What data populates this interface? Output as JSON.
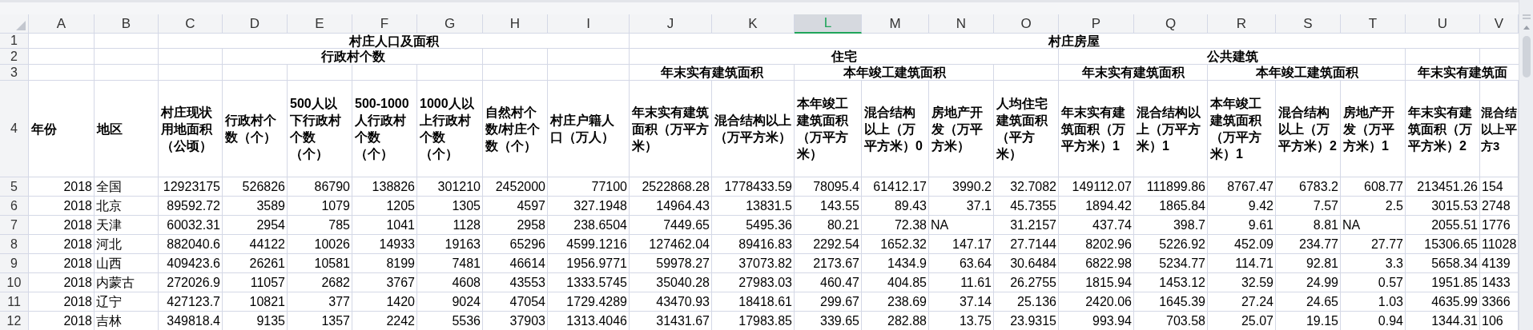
{
  "column_headers": [
    {
      "label": "A",
      "selected": false
    },
    {
      "label": "B",
      "selected": false
    },
    {
      "label": "C",
      "selected": false
    },
    {
      "label": "D",
      "selected": false
    },
    {
      "label": "E",
      "selected": false
    },
    {
      "label": "F",
      "selected": false
    },
    {
      "label": "G",
      "selected": false
    },
    {
      "label": "H",
      "selected": false
    },
    {
      "label": "I",
      "selected": false
    },
    {
      "label": "J",
      "selected": false
    },
    {
      "label": "K",
      "selected": false
    },
    {
      "label": "L",
      "selected": true
    },
    {
      "label": "M",
      "selected": false
    },
    {
      "label": "N",
      "selected": false
    },
    {
      "label": "O",
      "selected": false
    },
    {
      "label": "P",
      "selected": false
    },
    {
      "label": "Q",
      "selected": false
    },
    {
      "label": "R",
      "selected": false
    },
    {
      "label": "S",
      "selected": false
    },
    {
      "label": "T",
      "selected": false
    },
    {
      "label": "U",
      "selected": false
    },
    {
      "label": "V",
      "selected": false
    }
  ],
  "group_header_rows": [
    {
      "row": "1",
      "cells": [
        {
          "joined": false
        },
        {
          "joined": false
        },
        {
          "text": "村庄人口及面积",
          "joined": false
        },
        {
          "joined": true
        },
        {
          "joined": true
        },
        {
          "joined": true
        },
        {
          "joined": true
        },
        {
          "joined": true
        },
        {
          "joined": true
        },
        {
          "text": "村庄房屋",
          "joined": false
        },
        {
          "joined": true
        },
        {
          "joined": true
        },
        {
          "joined": true
        },
        {
          "joined": true
        },
        {
          "joined": true
        },
        {
          "joined": true
        },
        {
          "joined": true
        },
        {
          "joined": true
        },
        {
          "joined": true
        },
        {
          "joined": true
        },
        {
          "joined": true
        },
        {
          "joined": true
        }
      ]
    },
    {
      "row": "2",
      "cells": [
        {
          "joined": false
        },
        {
          "joined": false
        },
        {
          "joined": false
        },
        {
          "text": "行政村个数",
          "joined": false
        },
        {
          "joined": true
        },
        {
          "joined": true
        },
        {
          "joined": true
        },
        {
          "joined": false
        },
        {
          "joined": false
        },
        {
          "text": "住宅",
          "joined": false
        },
        {
          "joined": true
        },
        {
          "joined": true
        },
        {
          "joined": true
        },
        {
          "joined": true
        },
        {
          "joined": true
        },
        {
          "text": "公共建筑",
          "joined": false
        },
        {
          "joined": true
        },
        {
          "joined": true
        },
        {
          "joined": true
        },
        {
          "joined": true
        },
        {
          "joined": false
        },
        {
          "joined": false
        }
      ]
    },
    {
      "row": "3",
      "cells": [
        {
          "joined": false
        },
        {
          "joined": false
        },
        {
          "joined": false
        },
        {
          "joined": false
        },
        {
          "joined": false
        },
        {
          "joined": false
        },
        {
          "joined": false
        },
        {
          "joined": false
        },
        {
          "joined": false
        },
        {
          "text": "年末实有建筑面积",
          "joined": false
        },
        {
          "joined": true
        },
        {
          "text": "本年竣工建筑面积",
          "joined": false
        },
        {
          "joined": true
        },
        {
          "joined": true
        },
        {
          "joined": false
        },
        {
          "text": "年末实有建筑面积",
          "joined": false
        },
        {
          "joined": true
        },
        {
          "text": "本年竣工建筑面积",
          "joined": false
        },
        {
          "joined": true
        },
        {
          "joined": true
        },
        {
          "text": "年末实有建筑面",
          "joined": false
        },
        {
          "joined": true
        }
      ]
    }
  ],
  "field_header_row": {
    "row": "4",
    "cells": [
      "年份",
      "地区",
      "村庄现状用地面积（公顷）",
      "行政村个数（个）",
      "500人以下行政村个数（个）",
      "500-1000人行政村个数（个）",
      "1000人以上行政村个数（个）",
      "自然村个数/村庄个数（个）",
      "村庄户籍人口（万人）",
      "年末实有建筑面积（万平方米）",
      "混合结构以上（万平方米）",
      "本年竣工建筑面积（万平方米）",
      "混合结构以上（万平方米）0",
      "房地产开发（万平方米）",
      "人均住宅建筑面积（平方米）",
      "年末实有建筑面积（万平方米）1",
      "混合结构以上（万平方米）1",
      "本年竣工建筑面积（万平方米）1",
      "混合结构以上（万平方米）2",
      "房地产开发（万平方米）1",
      "年末实有建筑面积（万平方米）2",
      "混合结以上平方3"
    ]
  },
  "data_rows": [
    {
      "row": "5",
      "cells": [
        "2018",
        "全国",
        "12923175",
        "526826",
        "86790",
        "138826",
        "301210",
        "2452000",
        "77100",
        "2522868.28",
        "1778433.59",
        "78095.4",
        "61412.17",
        "3990.2",
        "32.7082",
        "149112.07",
        "111899.86",
        "8767.47",
        "6783.2",
        "608.77",
        "213451.26",
        "154"
      ]
    },
    {
      "row": "6",
      "cells": [
        "2018",
        "北京",
        "89592.72",
        "3589",
        "1079",
        "1205",
        "1305",
        "4597",
        "327.1948",
        "14964.43",
        "13831.5",
        "143.55",
        "89.43",
        "37.1",
        "45.7355",
        "1894.42",
        "1865.84",
        "9.42",
        "7.57",
        "2.5",
        "3015.53",
        "2748"
      ]
    },
    {
      "row": "7",
      "cells": [
        "2018",
        "天津",
        "60032.31",
        "2954",
        "785",
        "1041",
        "1128",
        "2958",
        "238.6504",
        "7449.65",
        "5495.36",
        "80.21",
        "72.38",
        "NA",
        "31.2157",
        "437.74",
        "398.7",
        "9.61",
        "8.81",
        "NA",
        "2055.51",
        "1776"
      ]
    },
    {
      "row": "8",
      "cells": [
        "2018",
        "河北",
        "882040.6",
        "44122",
        "10026",
        "14933",
        "19163",
        "65296",
        "4599.1216",
        "127462.04",
        "89416.83",
        "2292.54",
        "1652.32",
        "147.17",
        "27.7144",
        "8202.96",
        "5226.92",
        "452.09",
        "234.77",
        "27.77",
        "15306.65",
        "11028"
      ]
    },
    {
      "row": "9",
      "cells": [
        "2018",
        "山西",
        "409423.6",
        "26261",
        "10581",
        "8199",
        "7481",
        "46614",
        "1956.9771",
        "59978.27",
        "37073.82",
        "2173.67",
        "1434.9",
        "63.64",
        "30.6484",
        "6822.98",
        "5234.77",
        "114.71",
        "92.81",
        "3.3",
        "5658.34",
        "4139"
      ]
    },
    {
      "row": "10",
      "cells": [
        "2018",
        "内蒙古",
        "272026.9",
        "11057",
        "2682",
        "3767",
        "4608",
        "43553",
        "1333.5745",
        "35040.28",
        "27983.03",
        "460.47",
        "404.85",
        "11.61",
        "26.2755",
        "1815.94",
        "1453.12",
        "32.59",
        "24.99",
        "0.57",
        "1951.85",
        "1433"
      ]
    },
    {
      "row": "11",
      "cells": [
        "2018",
        "辽宁",
        "427123.7",
        "10821",
        "377",
        "1420",
        "9024",
        "47054",
        "1729.4289",
        "43470.93",
        "18418.61",
        "299.67",
        "238.69",
        "37.14",
        "25.136",
        "2420.06",
        "1645.39",
        "27.24",
        "24.65",
        "1.03",
        "4635.99",
        "3366"
      ]
    },
    {
      "row": "12",
      "cells": [
        "2018",
        "吉林",
        "349818.4",
        "9135",
        "1357",
        "2242",
        "5536",
        "37903",
        "1313.4046",
        "31431.67",
        "17983.85",
        "339.65",
        "282.88",
        "13.75",
        "23.9315",
        "993.94",
        "703.58",
        "25.07",
        "19.15",
        "0.94",
        "1344.31",
        "106"
      ]
    }
  ]
}
